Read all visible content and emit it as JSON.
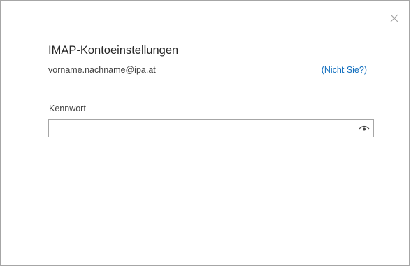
{
  "dialog": {
    "title": "IMAP-Kontoeinstellungen",
    "email": "vorname.nachname@ipa.at",
    "not_you_link": "(Nicht Sie?)",
    "password": {
      "label": "Kennwort",
      "value": "",
      "placeholder": ""
    },
    "icons": {
      "close": "close-icon",
      "reveal": "eye-icon"
    },
    "colors": {
      "link": "#106ebe",
      "border": "#a6a6a6",
      "text": "#262626"
    }
  }
}
